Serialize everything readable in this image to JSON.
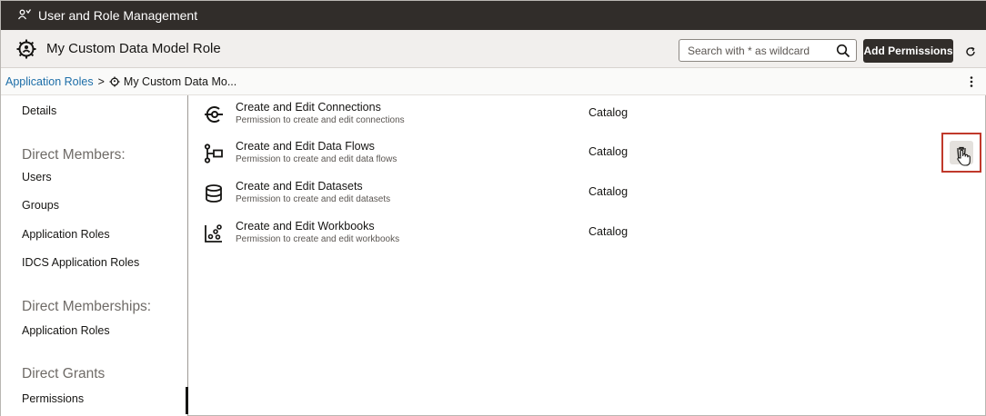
{
  "app": {
    "title": "User and Role Management",
    "title_icon": "users-icon"
  },
  "header": {
    "role_icon": "role-gear-icon",
    "role_title": "My Custom Data Model Role",
    "search": {
      "placeholder": "Search with * as wildcard",
      "value": "",
      "icon": "search-icon"
    },
    "add_button_label": "Add Permissions",
    "refresh_icon": "refresh-icon"
  },
  "breadcrumb": {
    "parent": "Application Roles",
    "separator": ">",
    "current": "My Custom Data Mo...",
    "current_icon": "role-gear-icon",
    "menu_icon": "kebab-menu-icon"
  },
  "sidebar": {
    "details": "Details",
    "direct_members_heading": "Direct Members:",
    "users": "Users",
    "groups": "Groups",
    "application_roles": "Application Roles",
    "idcs_application_roles": "IDCS Application Roles",
    "direct_memberships_heading": "Direct Memberships:",
    "memberships_application_roles": "Application Roles",
    "direct_grants_heading": "Direct Grants",
    "permissions": "Permissions",
    "selected": "Permissions"
  },
  "permissions": [
    {
      "icon": "connection-icon",
      "title": "Create and Edit Connections",
      "description": "Permission to create and edit connections",
      "category": "Catalog"
    },
    {
      "icon": "data-flow-icon",
      "title": "Create and Edit Data Flows",
      "description": "Permission to create and edit data flows",
      "category": "Catalog"
    },
    {
      "icon": "dataset-icon",
      "title": "Create and Edit Datasets",
      "description": "Permission to create and edit datasets",
      "category": "Catalog"
    },
    {
      "icon": "workbook-icon",
      "title": "Create and Edit Workbooks",
      "description": "Permission to create and edit workbooks",
      "category": "Catalog"
    }
  ],
  "row_actions": {
    "delete_icon": "trash-icon",
    "highlighted_row": 1
  },
  "colors": {
    "titlebar": "#312d2a",
    "link": "#1d6ea8",
    "highlight_border": "#c0392b",
    "button": "#312d2a"
  }
}
